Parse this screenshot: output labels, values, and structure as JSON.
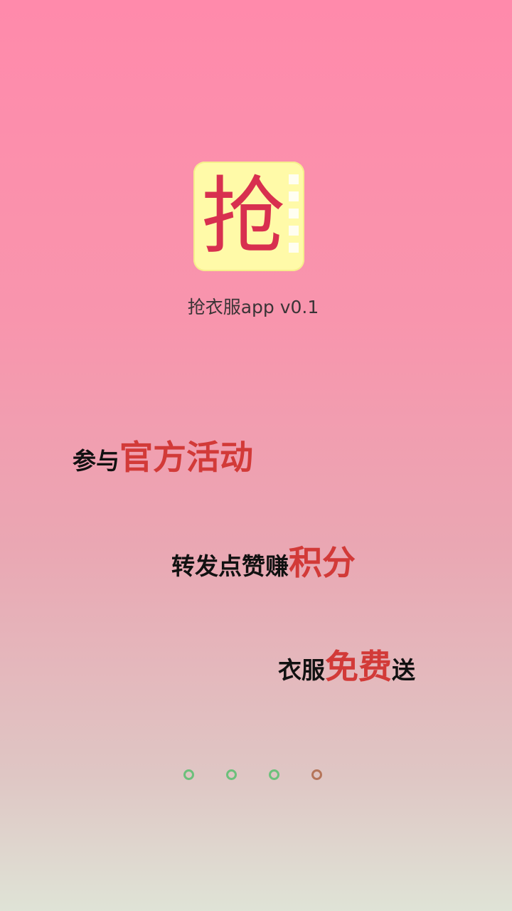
{
  "splash": {
    "icon_glyph": "抢",
    "app_name": "抢衣服app v0.1"
  },
  "slogans": [
    {
      "prefix": "参与",
      "highlight": "官方活动",
      "suffix": ""
    },
    {
      "prefix": "转发点赞赚",
      "highlight": "积分",
      "suffix": ""
    },
    {
      "prefix": "衣服",
      "highlight": "免费",
      "suffix": "送"
    }
  ],
  "pager": {
    "count": 4,
    "active_index": 3,
    "inactive_color": "#6cc07b",
    "active_color": "#b5755a"
  },
  "colors": {
    "gradient_top": "#ff8aab",
    "gradient_bottom": "#dfe3d6",
    "highlight_text": "#d23a38",
    "icon_background": "#fffaa8",
    "icon_glyph": "#d8304f"
  }
}
